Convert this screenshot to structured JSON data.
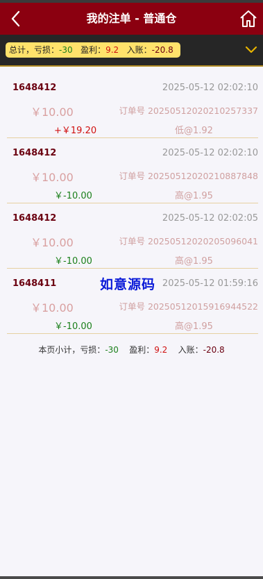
{
  "header": {
    "title": "我的注单 - 普通仓",
    "back_icon": "back-arrow-icon",
    "home_icon": "home-icon"
  },
  "summary": {
    "total_label": "总计，亏损：",
    "loss": "-30",
    "profit_label": "盈利：",
    "profit": "9.2",
    "income_label": "入账：",
    "income": "-20.8",
    "expand_icon": "chevron-down-icon"
  },
  "orders": [
    {
      "id": "1648412",
      "time": "2025-05-12 02:02:10",
      "amount": "￥10.00",
      "order_no": "订单号 20250512020210257337",
      "pl": "+￥19.20",
      "pick": "低@1.92",
      "pl_type": "pos"
    },
    {
      "id": "1648412",
      "time": "2025-05-12 02:02:10",
      "amount": "￥10.00",
      "order_no": "订单号 20250512020210887848",
      "pl": "￥-10.00",
      "pick": "高@1.95",
      "pl_type": "neg"
    },
    {
      "id": "1648412",
      "time": "2025-05-12 02:02:05",
      "amount": "￥10.00",
      "order_no": "订单号 20250512020205096041",
      "pl": "￥-10.00",
      "pick": "高@1.95",
      "pl_type": "neg"
    },
    {
      "id": "1648411",
      "time": "2025-05-12 01:59:16",
      "amount": "￥10.00",
      "order_no": "订单号 20250512015916944522",
      "pl": "￥-10.00",
      "pick": "高@1.95",
      "pl_type": "neg"
    }
  ],
  "watermark": "如意源码",
  "page_summary": {
    "label": "本页小计，亏损：",
    "loss": "-30",
    "profit_label": "盈利：",
    "profit": "9.2",
    "income_label": "入账：",
    "income": "-20.8"
  },
  "colors": {
    "header_bg": "#8b0010",
    "pill_bg": "#ffe26b",
    "loss": "#1a7f1a",
    "profit": "#d01010"
  }
}
